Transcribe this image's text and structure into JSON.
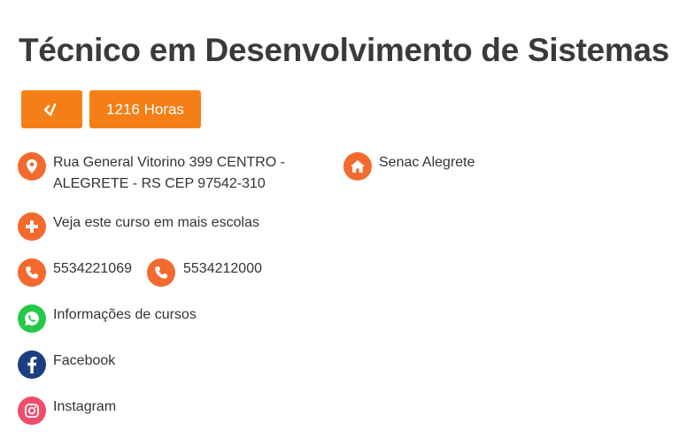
{
  "course": {
    "title": "Técnico em Desenvolvimento de Sistemas",
    "hours_label": "1216 Horas"
  },
  "info": {
    "address_line1": "Rua General Vitorino 399 CENTRO -",
    "address_line2": "ALEGRETE - RS CEP 97542-310",
    "school_name": "Senac Alegrete",
    "more_schools": "Veja este curso em mais escolas",
    "phone1": "5534221069",
    "phone2": "5534212000",
    "whatsapp": "Informações de cursos",
    "facebook": "Facebook",
    "instagram": "Instagram"
  },
  "icons": {
    "code": "code-icon",
    "location": "location-pin-icon",
    "home": "home-icon",
    "plus": "plus-icon",
    "phone": "phone-icon",
    "whatsapp": "whatsapp-icon",
    "facebook": "facebook-icon",
    "instagram": "instagram-icon"
  },
  "colors": {
    "badge": "#f57f17",
    "icon_orange": "#f26a2e",
    "whatsapp": "#25c94a",
    "facebook": "#1d3f82",
    "instagram": "#ee4d6b"
  }
}
